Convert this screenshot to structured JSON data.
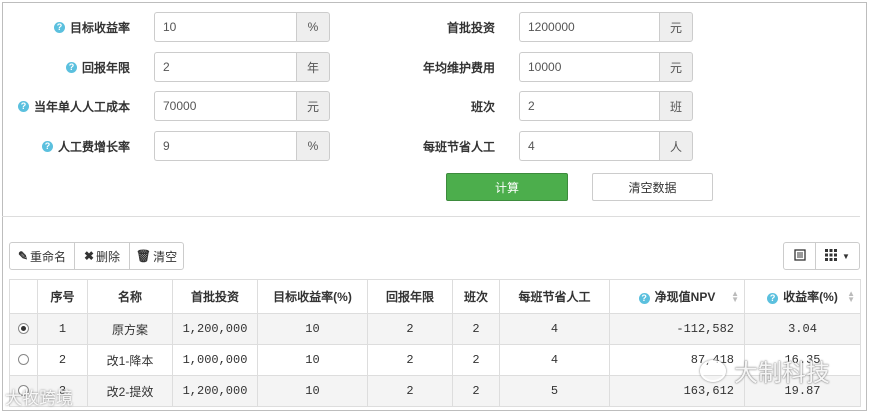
{
  "form": {
    "target_rate": {
      "label": "目标收益率",
      "value": "10",
      "unit": "%"
    },
    "payback_years": {
      "label": "回报年限",
      "value": "2",
      "unit": "年"
    },
    "labor_cost": {
      "label": "当年单人人工成本",
      "value": "70000",
      "unit": "元"
    },
    "labor_growth": {
      "label": "人工费增长率",
      "value": "9",
      "unit": "%"
    },
    "initial_invest": {
      "label": "首批投资",
      "value": "1200000",
      "unit": "元"
    },
    "maintenance": {
      "label": "年均维护费用",
      "value": "10000",
      "unit": "元"
    },
    "shifts": {
      "label": "班次",
      "value": "2",
      "unit": "班"
    },
    "saved_staff": {
      "label": "每班节省人工",
      "value": "4",
      "unit": "人"
    }
  },
  "buttons": {
    "calculate": "计算",
    "clear_data": "清空数据"
  },
  "toolbar": {
    "rename": "重命名",
    "delete": "删除",
    "clear": "清空"
  },
  "table": {
    "headers": [
      "序号",
      "名称",
      "首批投资",
      "目标收益率(%)",
      "回报年限",
      "班次",
      "每班节省人工",
      "净现值NPV",
      "收益率(%)"
    ],
    "rows": [
      {
        "selected": true,
        "cells": [
          "1",
          "原方案",
          "1,200,000",
          "10",
          "2",
          "2",
          "4",
          "-112,582",
          "3.04"
        ]
      },
      {
        "selected": false,
        "cells": [
          "2",
          "改1-降本",
          "1,000,000",
          "10",
          "2",
          "2",
          "4",
          "87,418",
          "16.35"
        ]
      },
      {
        "selected": false,
        "cells": [
          "3",
          "改2-提效",
          "1,200,000",
          "10",
          "2",
          "2",
          "5",
          "163,612",
          "19.87"
        ]
      }
    ]
  },
  "watermarks": {
    "right": "大制科技",
    "left": "大牧跨境"
  },
  "colors": {
    "calc_button": "#4cae4c",
    "info_icon": "#5bc0de"
  }
}
